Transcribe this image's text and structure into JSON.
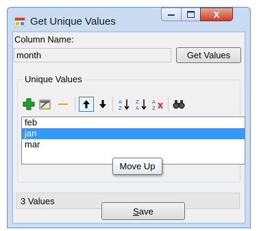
{
  "window": {
    "title": "Get Unique Values",
    "close_label": "X"
  },
  "form": {
    "column_name_label": "Column Name:",
    "column_name_value": "month",
    "get_values_button": "Get Values",
    "group_title": "Unique Values",
    "status": "3 Values",
    "save_underlined": "S",
    "save_rest": "ave"
  },
  "toolbar": {
    "tooltip": "Move Up",
    "icons": [
      "add-icon",
      "edit-icon",
      "remove-icon",
      "move-up-icon",
      "move-down-icon",
      "sort-ascending-icon",
      "sort-descending-icon",
      "clear-sort-icon",
      "find-icon"
    ]
  },
  "values": [
    "feb",
    "jan",
    "mar"
  ],
  "selected_index": 1,
  "colors": {
    "selection": "#3399ff",
    "title_bar": "#c9dcf1",
    "close_button": "#c7402a"
  }
}
